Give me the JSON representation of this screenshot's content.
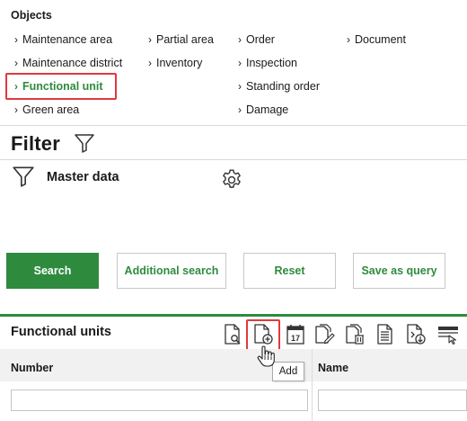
{
  "objects": {
    "title": "Objects",
    "col1": [
      "Maintenance area",
      "Maintenance district",
      "Functional unit",
      "Green area"
    ],
    "col2": [
      "Partial area",
      "Inventory"
    ],
    "col3": [
      "Order",
      "Inspection",
      "Standing order",
      "Damage"
    ],
    "col4": [
      "Document"
    ],
    "active": "Functional unit"
  },
  "filter": {
    "title": "Filter",
    "master_data_label": "Master data"
  },
  "buttons": {
    "search": "Search",
    "additional_search": "Additional search",
    "reset": "Reset",
    "save_as_query": "Save as query"
  },
  "results": {
    "title": "Functional units",
    "columns": [
      "Number",
      "Name"
    ],
    "filters": {
      "number": "",
      "name": ""
    },
    "toolbar_icons": [
      "document-search-icon",
      "document-add-icon",
      "calendar-icon",
      "document-edit-icon",
      "document-delete-icon",
      "document-text-icon",
      "document-export-icon",
      "table-settings-icon"
    ],
    "tooltip": "Add"
  },
  "colors": {
    "accent": "#2e8b3e",
    "highlight": "#e0393e"
  }
}
